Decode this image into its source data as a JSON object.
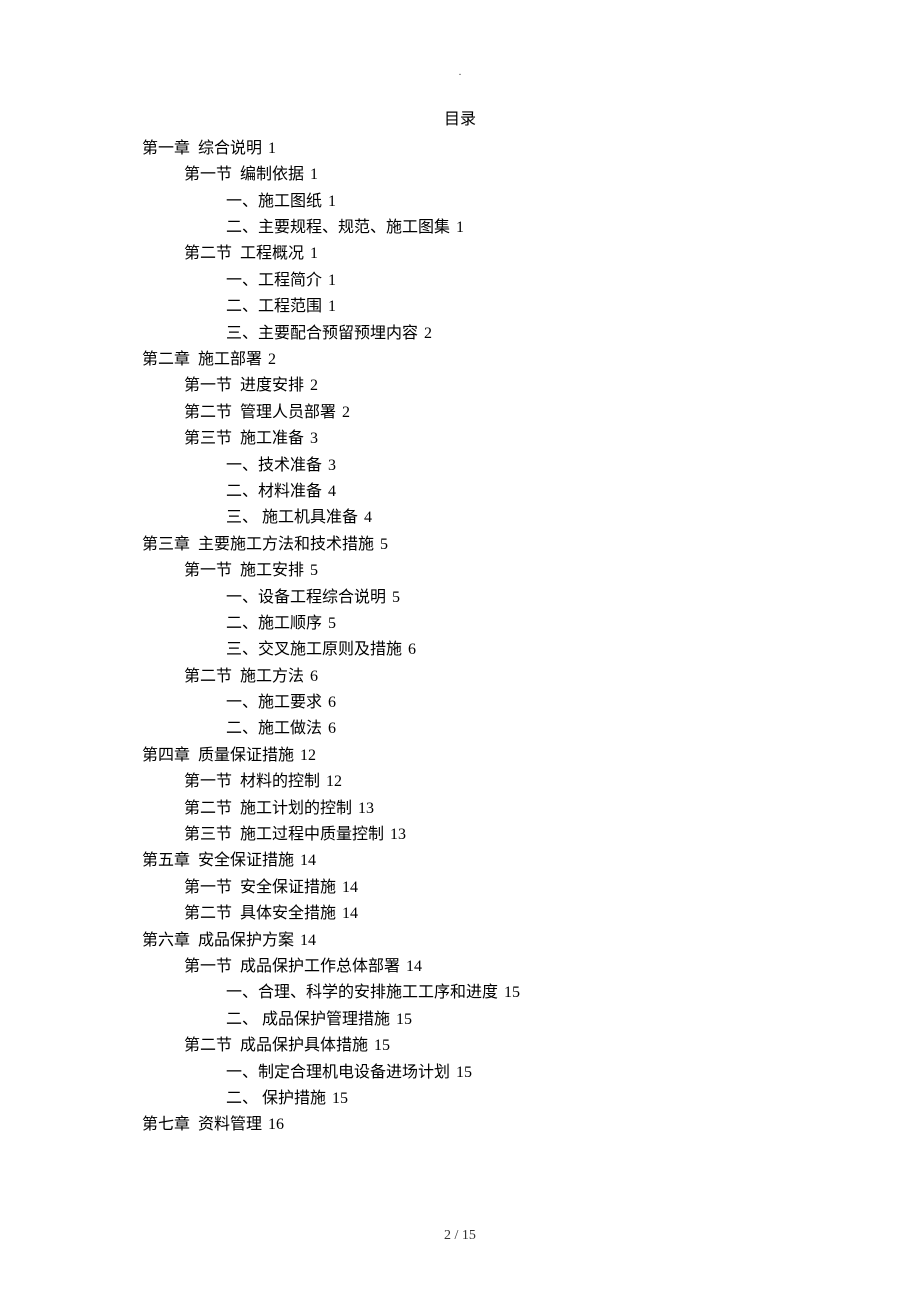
{
  "header_mark": ".",
  "title": "目录",
  "footer": "2  /  15",
  "toc": [
    {
      "level": 1,
      "label": "第一章",
      "text": "综合说明",
      "page": "1"
    },
    {
      "level": 2,
      "label": "第一节",
      "text": "编制依据",
      "page": "1"
    },
    {
      "level": 3,
      "label": "一、",
      "text": "施工图纸",
      "page": "1"
    },
    {
      "level": 3,
      "label": "二、",
      "text": "主要规程、规范、施工图集",
      "page": "1"
    },
    {
      "level": 2,
      "label": "第二节",
      "text": "工程概况",
      "page": "1"
    },
    {
      "level": 3,
      "label": "一、",
      "text": "工程简介",
      "page": "1"
    },
    {
      "level": 3,
      "label": "二、",
      "text": "工程范围",
      "page": "1"
    },
    {
      "level": 3,
      "label": "三、",
      "text": "主要配合预留预埋内容",
      "page": "2"
    },
    {
      "level": 1,
      "label": "第二章",
      "text": "施工部署",
      "page": "2"
    },
    {
      "level": 2,
      "label": "第一节",
      "text": "进度安排",
      "page": "2"
    },
    {
      "level": 2,
      "label": "第二节",
      "text": "管理人员部署",
      "page": "2"
    },
    {
      "level": 2,
      "label": "第三节",
      "text": "施工准备",
      "page": "3"
    },
    {
      "level": 3,
      "label": "一、",
      "text": "技术准备",
      "page": "3"
    },
    {
      "level": 3,
      "label": "二、",
      "text": "材料准备",
      "page": "4"
    },
    {
      "level": 3,
      "label": "三、",
      "text": " 施工机具准备",
      "page": "4"
    },
    {
      "level": 1,
      "label": "第三章",
      "text": "主要施工方法和技术措施",
      "page": "5"
    },
    {
      "level": 2,
      "label": "第一节",
      "text": "施工安排",
      "page": "5"
    },
    {
      "level": 3,
      "label": "一、",
      "text": "设备工程综合说明",
      "page": "5"
    },
    {
      "level": 3,
      "label": "二、",
      "text": "施工顺序",
      "page": "5"
    },
    {
      "level": 3,
      "label": "三、",
      "text": "交叉施工原则及措施",
      "page": "6"
    },
    {
      "level": 2,
      "label": "第二节",
      "text": "施工方法",
      "page": "6"
    },
    {
      "level": 3,
      "label": "一、",
      "text": "施工要求",
      "page": "6"
    },
    {
      "level": 3,
      "label": "二、",
      "text": "施工做法",
      "page": "6"
    },
    {
      "level": 1,
      "label": "第四章",
      "text": "质量保证措施",
      "page": "12"
    },
    {
      "level": 2,
      "label": "第一节",
      "text": "材料的控制",
      "page": "12"
    },
    {
      "level": 2,
      "label": "第二节",
      "text": "施工计划的控制",
      "page": "13"
    },
    {
      "level": 2,
      "label": "第三节",
      "text": "施工过程中质量控制",
      "page": "13"
    },
    {
      "level": 1,
      "label": "第五章",
      "text": "安全保证措施",
      "page": "14"
    },
    {
      "level": 2,
      "label": "第一节",
      "text": "安全保证措施",
      "page": "14"
    },
    {
      "level": 2,
      "label": "第二节",
      "text": "具体安全措施",
      "page": "14"
    },
    {
      "level": 1,
      "label": "第六章",
      "text": "成品保护方案",
      "page": "14"
    },
    {
      "level": 2,
      "label": "第一节",
      "text": "成品保护工作总体部署",
      "page": "14"
    },
    {
      "level": 3,
      "label": "一、",
      "text": "合理、科学的安排施工工序和进度",
      "page": "15"
    },
    {
      "level": 3,
      "label": "二、",
      "text": " 成品保护管理措施",
      "page": "15"
    },
    {
      "level": 2,
      "label": "第二节",
      "text": "成品保护具体措施",
      "page": "15"
    },
    {
      "level": 3,
      "label": "一、",
      "text": "制定合理机电设备进场计划",
      "page": "15"
    },
    {
      "level": 3,
      "label": "二、",
      "text": " 保护措施",
      "page": "15"
    },
    {
      "level": 1,
      "label": "第七章",
      "text": "资料管理",
      "page": "16"
    }
  ]
}
